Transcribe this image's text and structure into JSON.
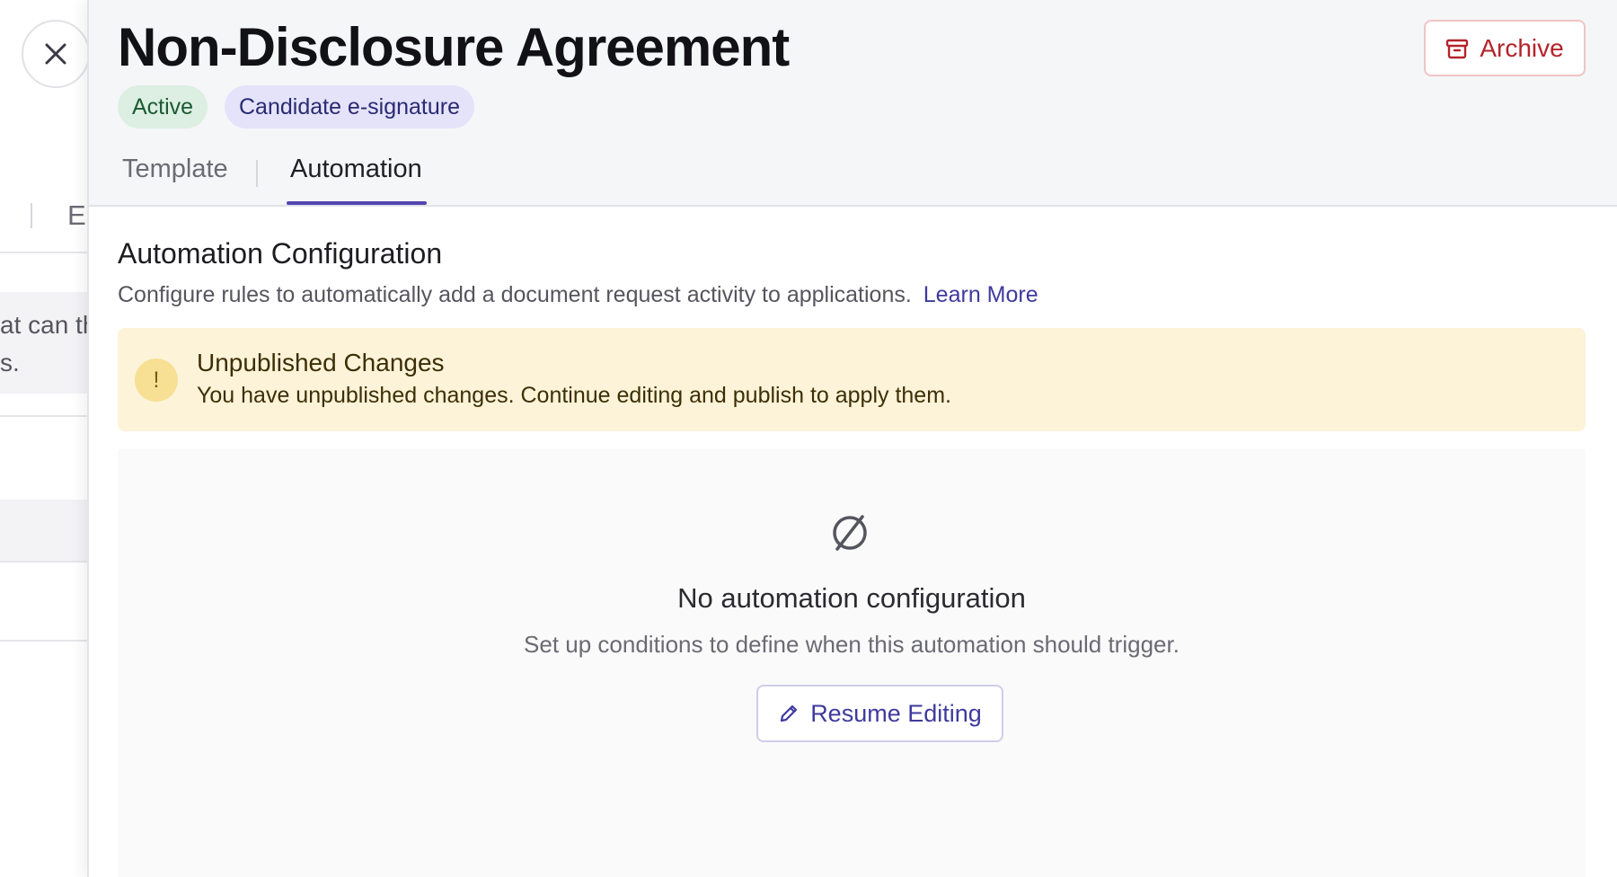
{
  "background_page": {
    "tab_fragment": "E",
    "card_text_line1": "at can th",
    "card_text_line2": "s."
  },
  "drawer": {
    "title": "Non-Disclosure Agreement",
    "badges": [
      "Active",
      "Candidate e-signature"
    ],
    "archive_label": "Archive",
    "tabs": [
      {
        "label": "Template",
        "active": false
      },
      {
        "label": "Automation",
        "active": true
      }
    ],
    "section": {
      "title": "Automation Configuration",
      "description": "Configure rules to automatically add a document request activity to applications.",
      "learn_more": "Learn More"
    },
    "alert": {
      "icon_glyph": "!",
      "title": "Unpublished Changes",
      "text": "You have unpublished changes. Continue editing and publish to apply them."
    },
    "empty_state": {
      "title": "No automation configuration",
      "description": "Set up conditions to define when this automation should trigger.",
      "button_label": "Resume Editing"
    }
  },
  "icons": {
    "close": "close-icon",
    "archive": "archive-box-icon",
    "alert": "exclamation-icon",
    "empty": "empty-set-icon",
    "edit": "pencil-icon"
  },
  "colors": {
    "accent": "#5246b0",
    "danger": "#b4232a",
    "alert_bg": "#fdf3d8",
    "active_badge_bg": "#dcefe2",
    "esign_badge_bg": "#e4e3fa"
  }
}
